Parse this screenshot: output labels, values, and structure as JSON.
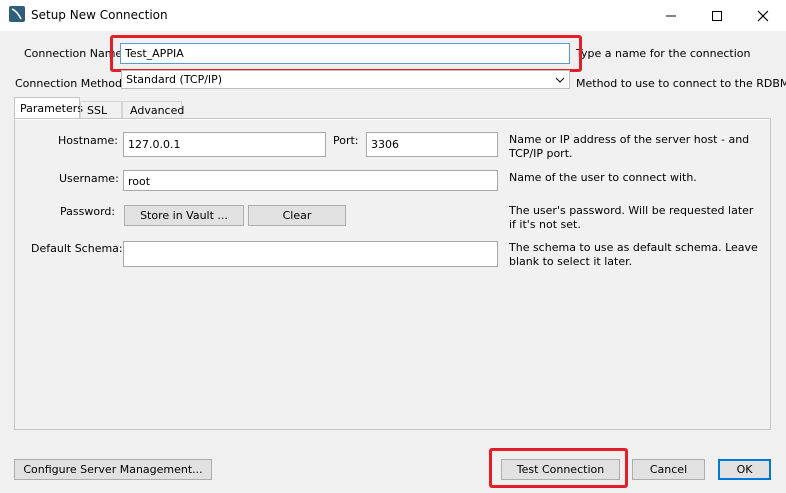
{
  "window": {
    "title": "Setup New Connection"
  },
  "connection_name": {
    "label": "Connection Name:",
    "value": "Test_APPIA",
    "help": "Type a name for the connection"
  },
  "connection_method": {
    "label": "Connection Method:",
    "value": "Standard (TCP/IP)",
    "help": "Method to use to connect to the RDBMS"
  },
  "tabs": [
    {
      "label": "Parameters"
    },
    {
      "label": "SSL"
    },
    {
      "label": "Advanced"
    }
  ],
  "params": {
    "hostname": {
      "label": "Hostname:",
      "value": "127.0.0.1"
    },
    "port": {
      "label": "Port:",
      "value": "3306"
    },
    "host_help": "Name or IP address of the server host - and TCP/IP port.",
    "username": {
      "label": "Username:",
      "value": "root",
      "help": "Name of the user to connect with."
    },
    "password": {
      "label": "Password:",
      "store_label": "Store in Vault ...",
      "clear_label": "Clear",
      "help": "The user's password. Will be requested later if it's not set."
    },
    "schema": {
      "label": "Default Schema:",
      "value": "",
      "help": "The schema to use as default schema. Leave blank to select it later."
    }
  },
  "footer": {
    "configure_label": "Configure Server Management...",
    "test_label": "Test Connection",
    "cancel_label": "Cancel",
    "ok_label": "OK"
  },
  "colors": {
    "highlight": "#e41e26",
    "ok_border": "#0078d7"
  }
}
